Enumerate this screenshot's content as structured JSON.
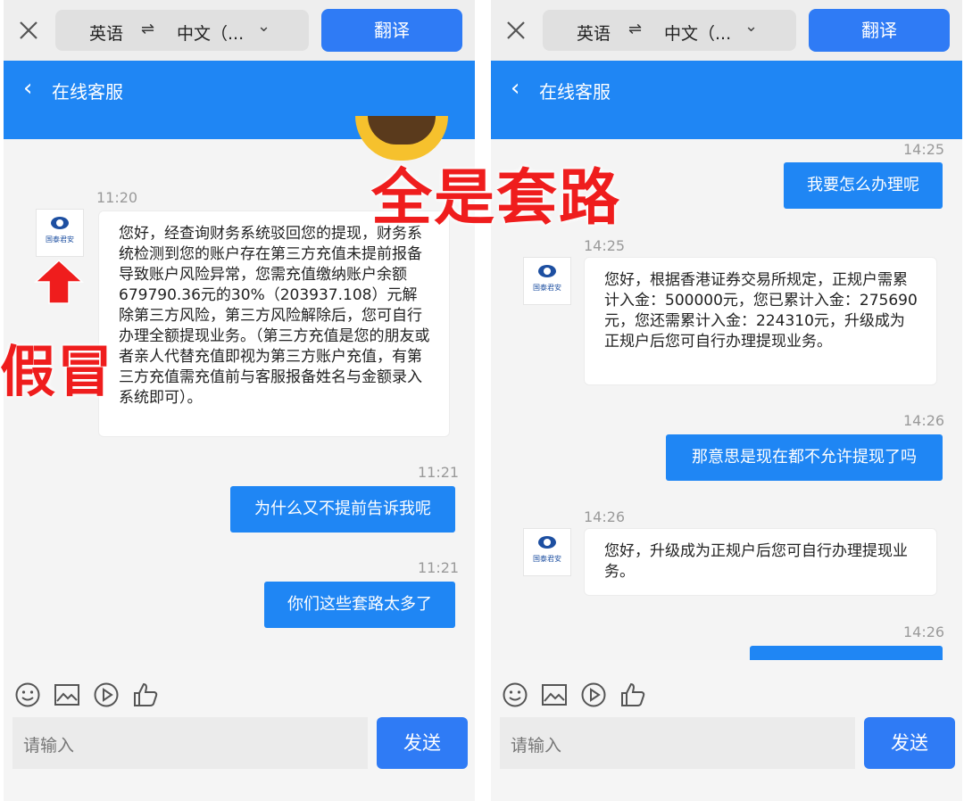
{
  "panels": [
    {
      "toolbar": {
        "source_lang": "英语",
        "swap_glyph": "⇌",
        "target_lang": "中文（...",
        "translate_label": "翻译"
      },
      "header": {
        "back_glyph": "‹",
        "title": "在线客服"
      },
      "messages": [
        {
          "time": "11:20"
        },
        {
          "incoming": "您好，经查询财务系统驳回您的提现，财务系统检测到您的账户存在第三方充值未提前报备导致账户风险异常，您需充值缴纳账户余额679790.36元的30%（203937.108）元解除第三方风险，第三方风险解除后，您可自行办理全额提现业务。（第三方充值是您的朋友或者亲人代替充值即视为第三方账户充值，有第三方充值需充值前与客服报备姓名与金额录入系统即可）。"
        },
        {
          "time": "11:21"
        },
        {
          "outgoing": "为什么又不提前告诉我呢"
        },
        {
          "time": "11:21"
        },
        {
          "outgoing": "你们这些套路太多了"
        }
      ],
      "footer": {
        "placeholder": "请输入",
        "send_label": "发送"
      }
    },
    {
      "toolbar": {
        "source_lang": "英语",
        "swap_glyph": "⇌",
        "target_lang": "中文（...",
        "translate_label": "翻译"
      },
      "header": {
        "back_glyph": "‹",
        "title": "在线客服"
      },
      "messages": [
        {
          "time": "14:25"
        },
        {
          "outgoing": "我要怎么办理呢"
        },
        {
          "time": "14:25"
        },
        {
          "incoming": "您好，根据香港证券交易所规定，正规户需累计入金：500000元，您已累计入金：275690元，您还需累计入金：224310元，升级成为正规户后您可自行办理提现业务。"
        },
        {
          "time": "14:26"
        },
        {
          "outgoing": "那意思是现在都不允许提现了吗"
        },
        {
          "time": "14:26"
        },
        {
          "incoming": "您好，升级成为正规户后您可自行办理提现业务。"
        },
        {
          "time": "14:26"
        }
      ],
      "footer": {
        "placeholder": "请输入",
        "send_label": "发送"
      }
    }
  ],
  "avatar_text": "国泰君安",
  "overlays": {
    "scam": "全是套路",
    "fake": "假冒"
  },
  "colors": {
    "accent": "#1f86f4",
    "button": "#2f7bf5",
    "overlay_red": "#ef1d1d"
  }
}
